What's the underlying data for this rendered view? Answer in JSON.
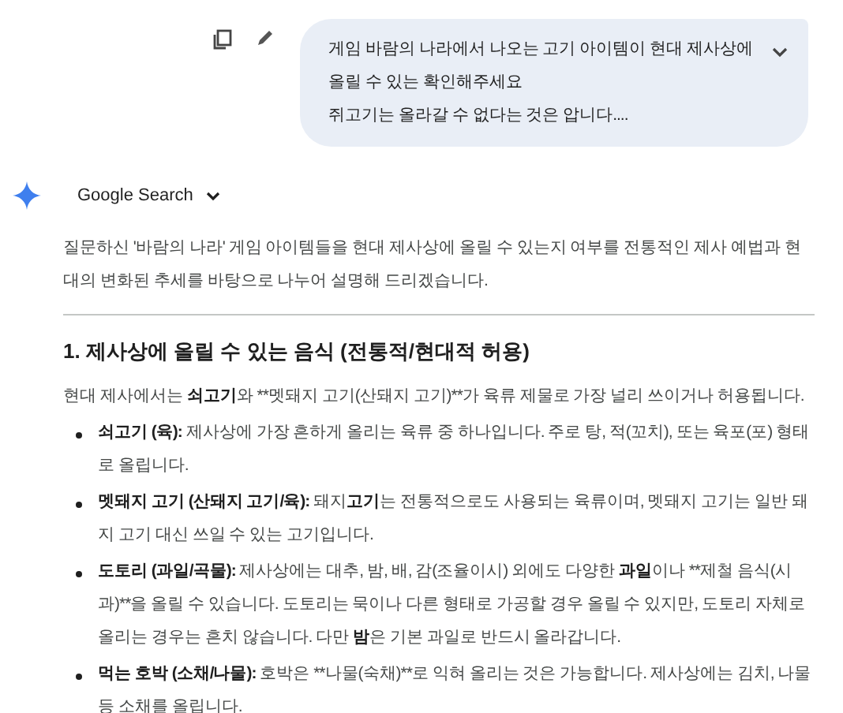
{
  "query": {
    "lines": [
      "게임 바람의 나라에서 나오는 고기 아이템이 현대 제사상에 올릴 수 있는 확인해주세요",
      "쥐고기는 올라갈 수 없다는 것은 압니다...."
    ]
  },
  "answer": {
    "source": "Google Search",
    "intro": "질문하신 '바람의 나라' 게임 아이템들을 현대 제사상에 올릴 수 있는지 여부를 전통적인 제사 예법과 현대의 변화된 추세를 바탕으로 나누어 설명해 드리겠습니다.",
    "heading": "1. 제사상에 올릴 수 있는 음식 (전통적/현대적 허용)",
    "lead": [
      {
        "text": "현대 제사에서는 ",
        "bold": false
      },
      {
        "text": "쇠고기",
        "bold": true
      },
      {
        "text": "와 **멧돼지 고기(산돼지 고기)**가 육류 제물로 가장 널리 쓰이거나 허용됩니다.",
        "bold": false
      }
    ],
    "bullets": [
      [
        {
          "text": "쇠고기 (육):",
          "bold": true
        },
        {
          "text": " 제사상에 가장 흔하게 올리는 육류 중 하나입니다. 주로 탕, 적(꼬치), 또는 육포(포) 형태로 올립니다.",
          "bold": false
        }
      ],
      [
        {
          "text": "멧돼지 고기 (산돼지 고기/육):",
          "bold": true
        },
        {
          "text": " 돼지",
          "bold": false
        },
        {
          "text": "고기",
          "bold": true
        },
        {
          "text": "는 전통적으로도 사용되는 육류이며, 멧돼지 고기는 일반 돼지 고기 대신 쓰일 수 있는 고기입니다.",
          "bold": false
        }
      ],
      [
        {
          "text": "도토리 (과일/곡물):",
          "bold": true
        },
        {
          "text": " 제사상에는 대추, 밤, 배, 감(조율이시) 외에도 다양한 ",
          "bold": false
        },
        {
          "text": "과일",
          "bold": true
        },
        {
          "text": "이나 **제철 음식(시과)**을 올릴 수 있습니다. 도토리는 묵이나 다른 형태로 가공할 경우 올릴 수 있지만, 도토리 자체로 올리는 경우는 흔치 않습니다. 다만 ",
          "bold": false
        },
        {
          "text": "밤",
          "bold": true
        },
        {
          "text": "은 기본 과일로 반드시 올라갑니다.",
          "bold": false
        }
      ],
      [
        {
          "text": "먹는 호박 (소채/나물):",
          "bold": true
        },
        {
          "text": " 호박은 **나물(숙채)**로 익혀 올리는 것은 가능합니다. 제사상에는 김치, 나물 등 소채를 올립니다.",
          "bold": false
        }
      ]
    ]
  }
}
